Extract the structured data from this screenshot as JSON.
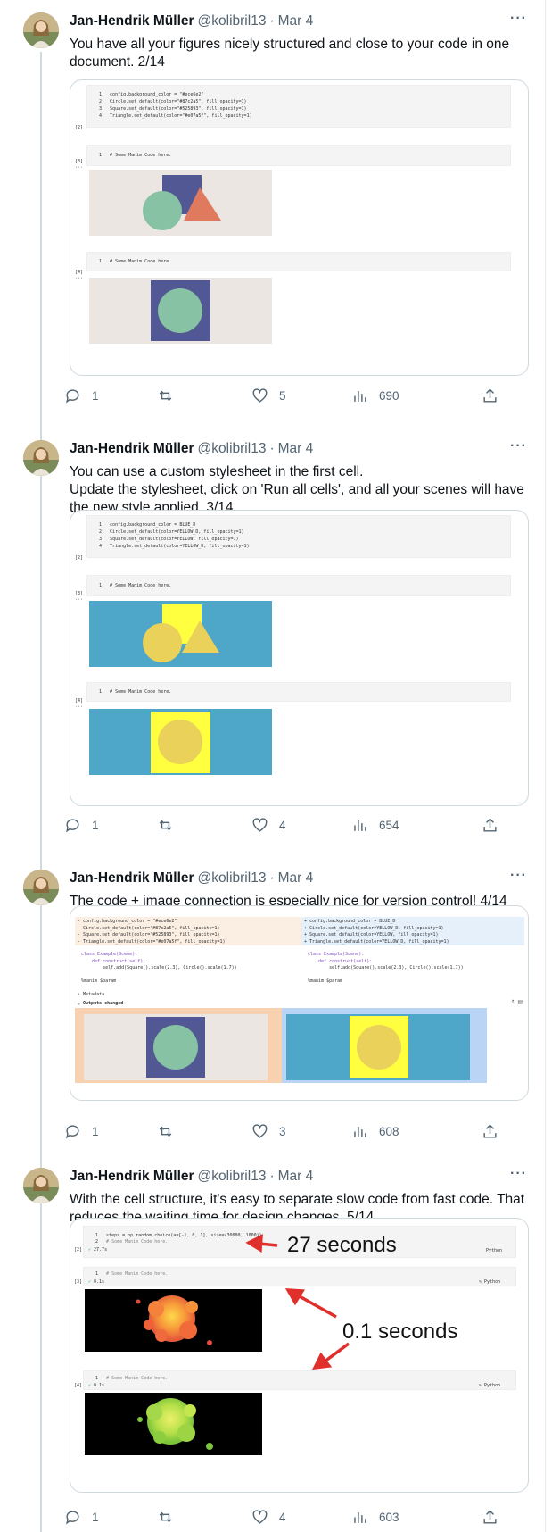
{
  "author": {
    "name": "Jan-Hendrik Müller",
    "handle": "@kolibril13"
  },
  "tweets": [
    {
      "date": "Mar 4",
      "text_lines": [
        "You have all your figures nicely structured and close to your code in one document. 2/14"
      ],
      "stats": {
        "replies": "1",
        "likes": "5",
        "views": "690"
      },
      "code": {
        "lines": [
          "config.background_color = \"#ece6e2\"",
          "Circle.set_default(color=\"#87c2a5\", fill_opacity=1)",
          "Square.set_default(color=\"#525893\", fill_opacity=1)",
          "Triangle.set_default(color=\"#e07a5f\", fill_opacity=1)"
        ],
        "cell_comment": "# Some Manim Code here.",
        "cell_comment2": "# Some Manim Code here",
        "labels": [
          "[2]",
          "[3]",
          "[4]"
        ]
      },
      "colors": {
        "bg": "#ece6e2",
        "circle": "#87c2a5",
        "square": "#525893",
        "triangle": "#e07a5f"
      }
    },
    {
      "date": "Mar 4",
      "text_lines": [
        "You can use a custom stylesheet in the first cell.",
        "Update the stylesheet, click on 'Run all cells', and all your scenes will have the new style applied. 3/14"
      ],
      "stats": {
        "replies": "1",
        "likes": "4",
        "views": "654"
      },
      "code": {
        "lines": [
          "config.background_color = BLUE_D",
          "Circle.set_default(color=YELLOW_D, fill_opacity=1)",
          "Square.set_default(color=YELLOW, fill_opacity=1)",
          "Triangle.set_default(color=YELLOW_D, fill_opacity=1)"
        ],
        "cell_comment": "# Some Manim Code here.",
        "labels": [
          "[2]",
          "[3]",
          "[4]"
        ]
      },
      "colors": {
        "bg": "#4ea6c8",
        "circle": "#ead25a",
        "square": "#ffff40",
        "triangle": "#ead25a"
      }
    },
    {
      "date": "Mar 4",
      "text_lines": [
        "The code + image connection is especially nice for version control! 4/14"
      ],
      "stats": {
        "replies": "1",
        "likes": "3",
        "views": "608"
      },
      "diff": {
        "left": [
          "- config.background_color = \"#ece6e2\"",
          "- Circle.set_default(color=\"#87c2a5\", fill_opacity=1)",
          "- Square.set_default(color=\"#525893\", fill_opacity=1)",
          "- Triangle.set_default(color=\"#e07a5f\", fill_opacity=1)"
        ],
        "right": [
          "+ config.background_color = BLUE_D",
          "+ Circle.set_default(color=YELLOW_D, fill_opacity=1)",
          "+ Square.set_default(color=YELLOW, fill_opacity=1)",
          "+ Triangle.set_default(color=YELLOW_D, fill_opacity=1)"
        ],
        "body": [
          "class Example(Scene):",
          "    def construct(self):",
          "        self.add(Square().scale(2.3), Circle().scale(1.7))"
        ],
        "magic": "%manim $param",
        "metadata_label": "Metadata",
        "outputs_label": "Outputs changed"
      }
    },
    {
      "date": "Mar 4",
      "text_lines": [
        "With the cell structure, it's easy to separate slow code from fast code. That reduces the waiting time for design changes. 5/14"
      ],
      "stats": {
        "replies": "1",
        "likes": "4",
        "views": "603"
      },
      "timing": {
        "code_line": "steps = np.random.choice(a=[-1, 0, 1], size=(30000, 1000))",
        "cell_comment": "# Some Manim Code here.",
        "time_slow": "27.7s",
        "time_fast": "0.1s",
        "lang": "Python",
        "annotation_slow": "27 seconds",
        "annotation_fast": "0.1 seconds",
        "labels": [
          "[2]",
          "[3]",
          "[4]"
        ]
      }
    }
  ],
  "icons": [
    "reply-icon",
    "retweet-icon",
    "like-icon",
    "views-icon",
    "share-icon",
    "more-icon"
  ]
}
